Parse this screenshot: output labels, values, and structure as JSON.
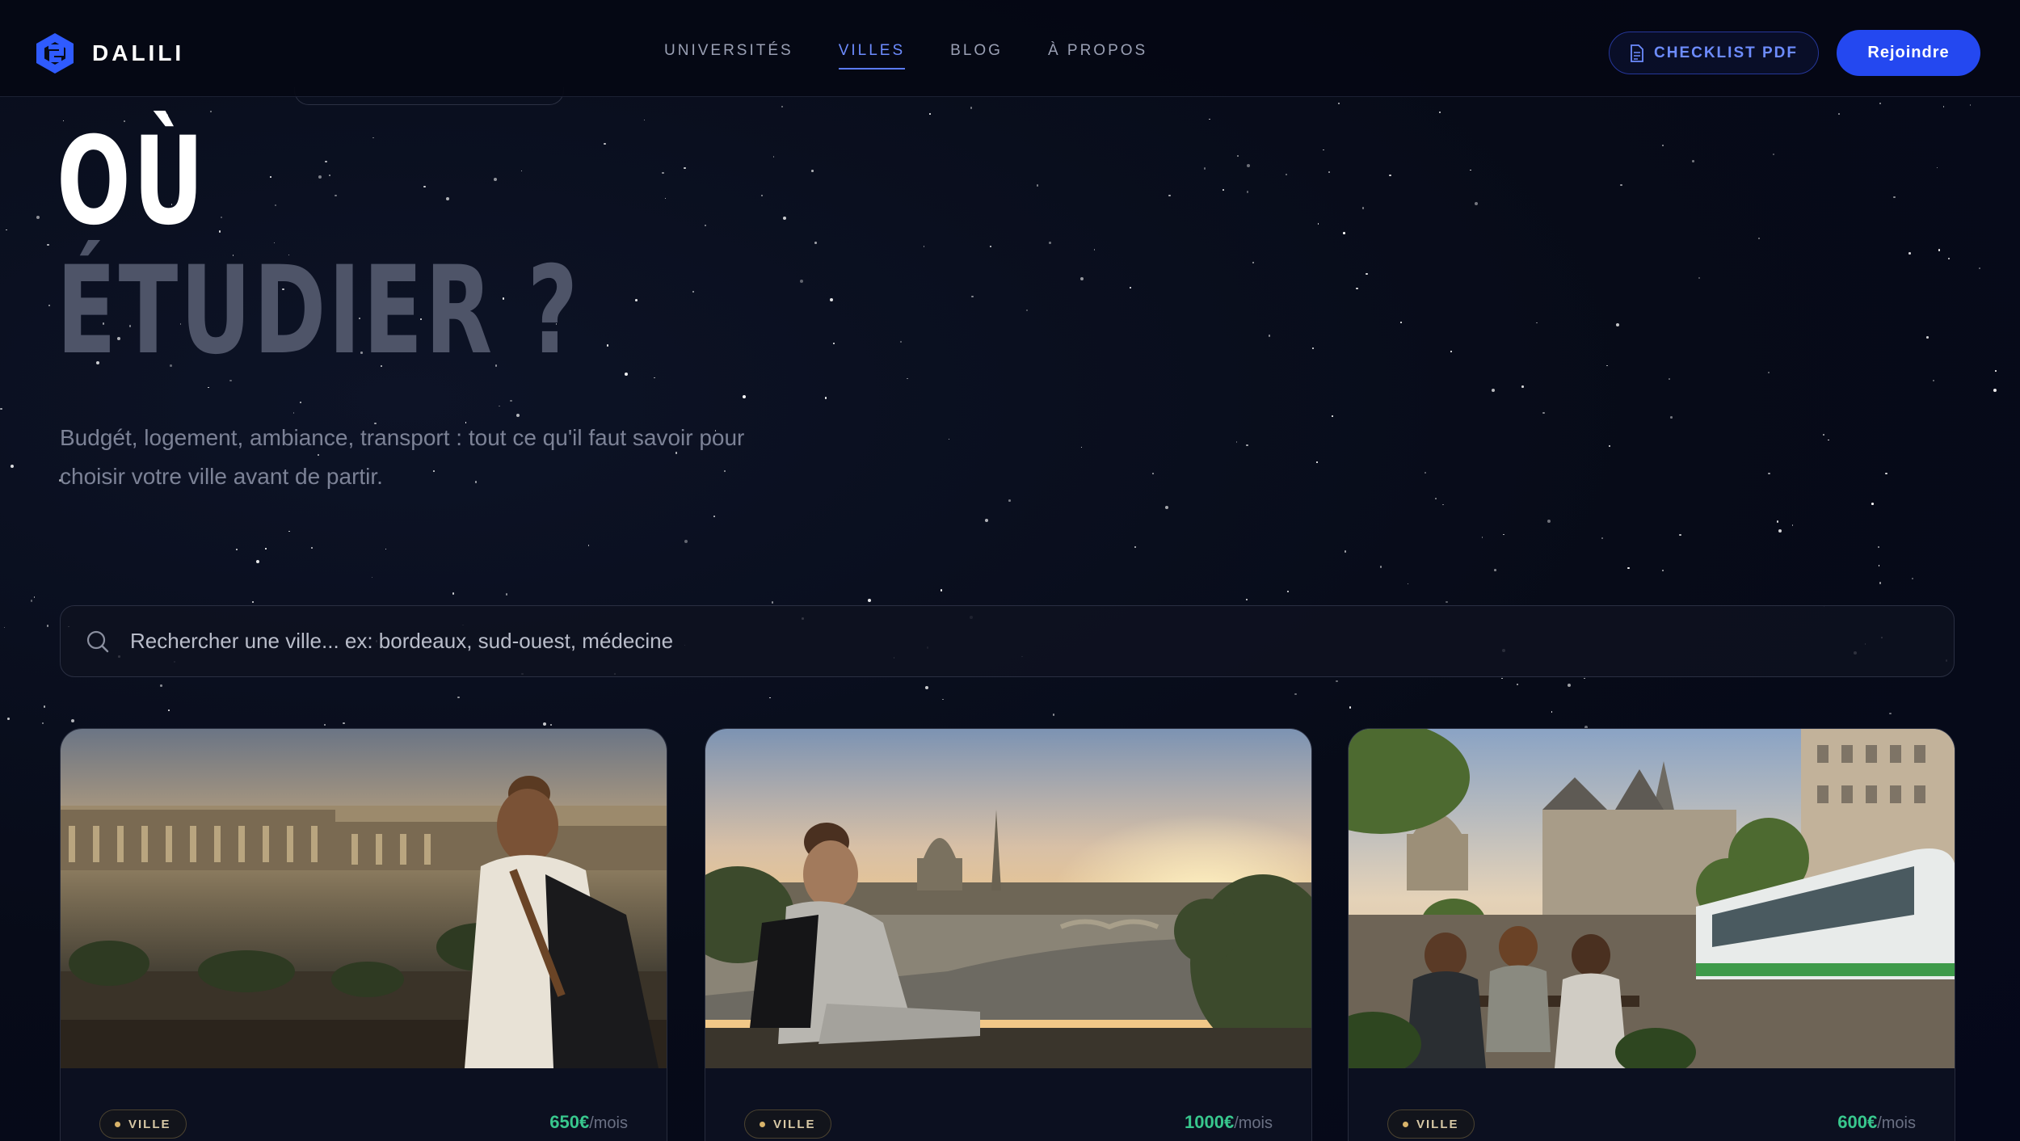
{
  "nav": {
    "brand": "DALILI",
    "links": [
      {
        "label": "UNIVERSITÉS",
        "active": false
      },
      {
        "label": "VILLES",
        "active": true
      },
      {
        "label": "BLOG",
        "active": false
      },
      {
        "label": "À PROPOS",
        "active": false
      }
    ],
    "checklist_label": "CHECKLIST PDF",
    "join_label": "Rejoindre"
  },
  "hero": {
    "title_line1": "OÙ",
    "title_line2": "ÉTUDIER ?",
    "subtitle": "Budgét, logement, ambiance, transport : tout ce qu'il faut savoir pour choisir votre ville avant de partir."
  },
  "search": {
    "placeholder": "Rechercher une ville... ex: bordeaux, sud-ouest, médecine"
  },
  "cards": [
    {
      "badge": "VILLE",
      "price": "650€",
      "unit": "/mois"
    },
    {
      "badge": "VILLE",
      "price": "1000€",
      "unit": "/mois"
    },
    {
      "badge": "VILLE",
      "price": "600€",
      "unit": "/mois"
    }
  ],
  "colors": {
    "accent": "#2448f0",
    "accent_text": "#6d8cff",
    "price": "#38c78d",
    "badge_dot": "#d8b36a"
  }
}
